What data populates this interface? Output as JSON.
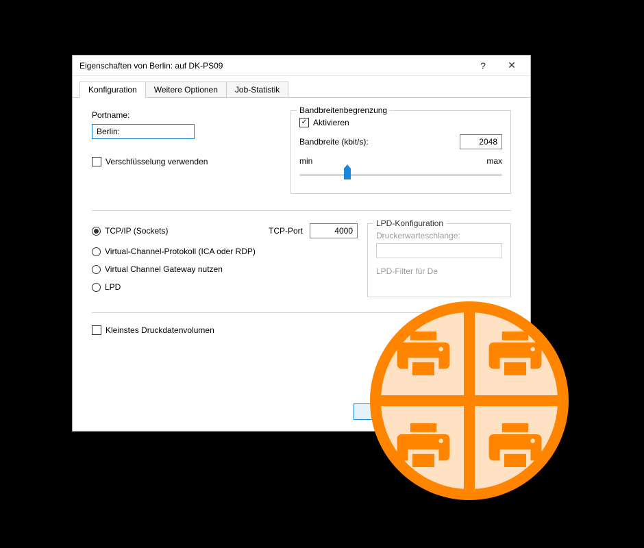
{
  "title": "Eigenschaften von Berlin: auf DK-PS09",
  "tabs": [
    {
      "label": "Konfiguration",
      "active": true
    },
    {
      "label": "Weitere Optionen",
      "active": false
    },
    {
      "label": "Job-Statistik",
      "active": false
    }
  ],
  "portname_label": "Portname:",
  "portname_value": "Berlin:",
  "encrypt_label": "Verschlüsselung verwenden",
  "encrypt_checked": false,
  "bandwidth": {
    "legend": "Bandbreitenbegrenzung",
    "enable_label": "Aktivieren",
    "enable_checked": true,
    "rate_label": "Bandbreite (kbit/s):",
    "rate_value": "2048",
    "min_label": "min",
    "max_label": "max"
  },
  "protocol": {
    "tcpip": "TCP/IP (Sockets)",
    "tcp_port_label": "TCP-Port",
    "tcp_port_value": "4000",
    "vcp": "Virtual-Channel-Protokoll (ICA oder RDP)",
    "vcg": "Virtual Channel Gateway nutzen",
    "lpd": "LPD"
  },
  "lpd_config": {
    "legend": "LPD-Konfiguration",
    "queue_label": "Druckerwarteschlange:",
    "filter_label": "LPD-Filter für De"
  },
  "smallest_volume_label": "Kleinstes Druckdatenvolumen",
  "ok_label": "OK"
}
